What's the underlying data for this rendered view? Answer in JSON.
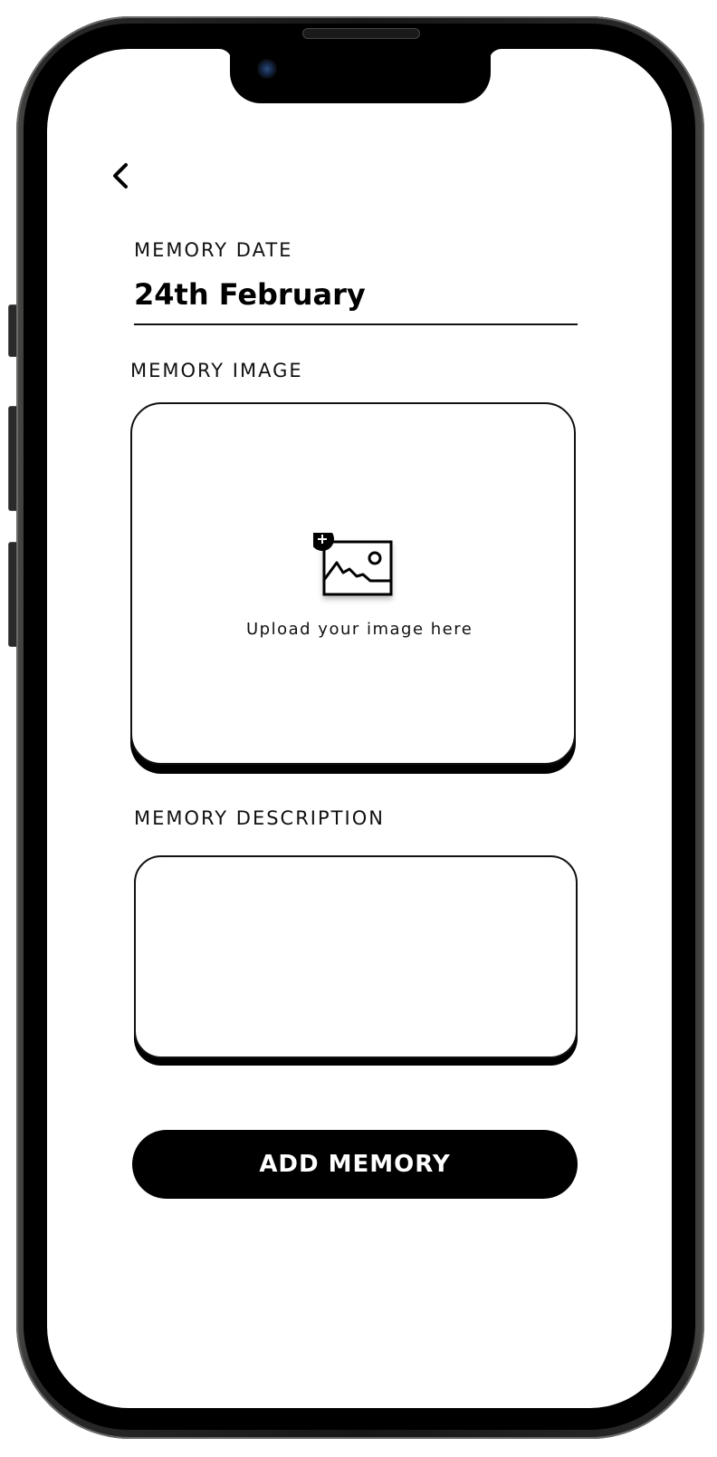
{
  "theme": {
    "background": "#ffffff",
    "text": "#111111",
    "accent": "#000000"
  },
  "nav": {
    "back_icon": "chevron-left-icon"
  },
  "form": {
    "date": {
      "label": "MEMORY DATE",
      "value": "24th February"
    },
    "image": {
      "label": "MEMORY IMAGE",
      "upload_icon": "add-image-icon",
      "upload_text": "Upload your image here"
    },
    "description": {
      "label": "MEMORY DESCRIPTION",
      "value": ""
    },
    "submit_label": "ADD MEMORY"
  }
}
